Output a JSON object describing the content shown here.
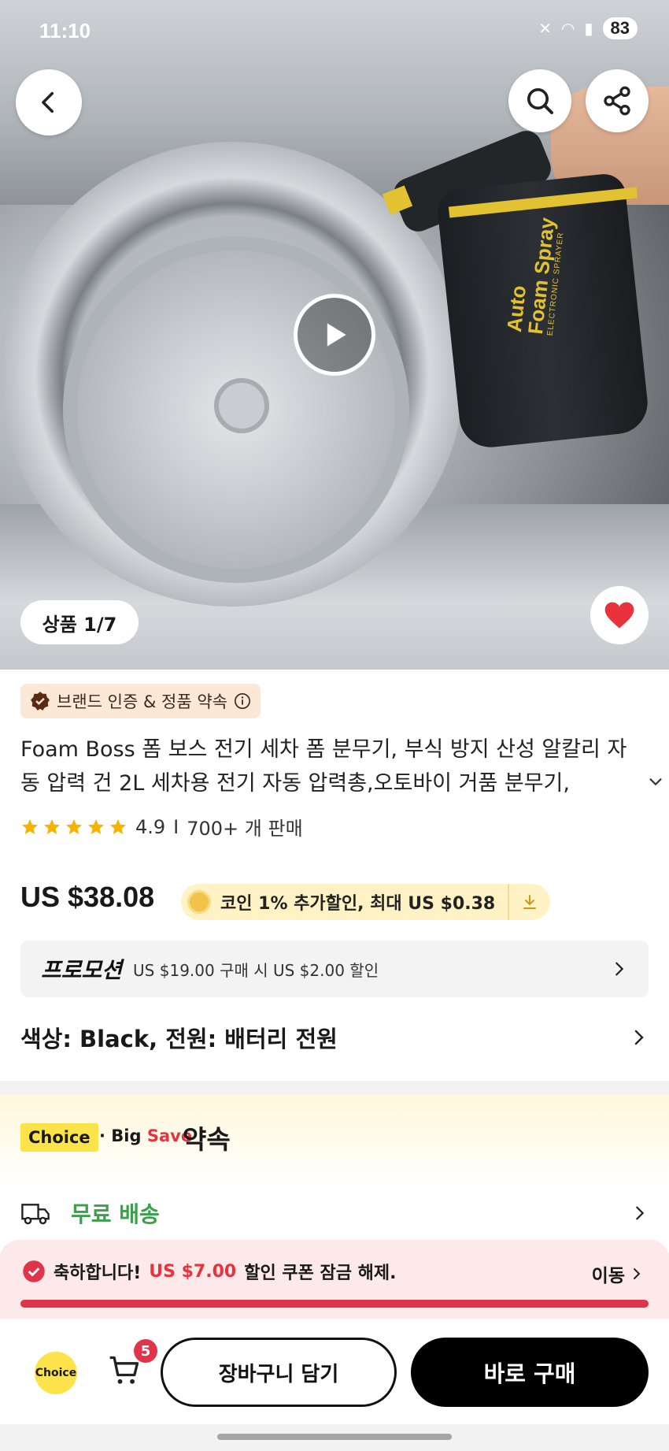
{
  "status_bar": {
    "time": "11:10",
    "battery": "83"
  },
  "hero": {
    "product_print_line1": "Auto",
    "product_print_line2": "Foam Spray",
    "product_print_line3": "ELECTRONIC SPRAYER",
    "image_counter": "상품 1/7"
  },
  "product": {
    "brand_badge": "브랜드 인증 & 정품 약속",
    "title": "Foam Boss 폼 보스 전기 세차 폼 분무기, 부식 방지 산성 알칼리 자동 압력 건 2L  세차용 전기 자동 압력총,오토바이 거품 분무기,",
    "rating": "4.9",
    "separator": "I",
    "sold": "700+ 개 판매",
    "stars": 5,
    "price": "US $38.08",
    "coin_offer": "코인 1% 추가할인, 최대 US $0.38",
    "promotion_label": "프로모션",
    "promotion_text": "US $19.00 구매 시 US $2.00 할인",
    "variant": "색상: Black, 전원: 배터리 전원"
  },
  "choice": {
    "tag": "Choice",
    "big": "· Big",
    "save": "Save",
    "promise": "약속",
    "shipping": "무료 배송"
  },
  "coupon": {
    "prefix": "축하합니다!",
    "amount": "US $7.00",
    "suffix": "할인 쿠폰 잠금 해제.",
    "go": "이동",
    "progress": 1.0
  },
  "bottom_bar": {
    "choice_label": "Choice",
    "cart_count": "5",
    "add_to_cart": "장바구니 담기",
    "buy_now": "바로 구매"
  },
  "colors": {
    "accent_red": "#e0344a",
    "choice_yellow": "#fde34a",
    "shipping_green": "#3aa04a"
  }
}
